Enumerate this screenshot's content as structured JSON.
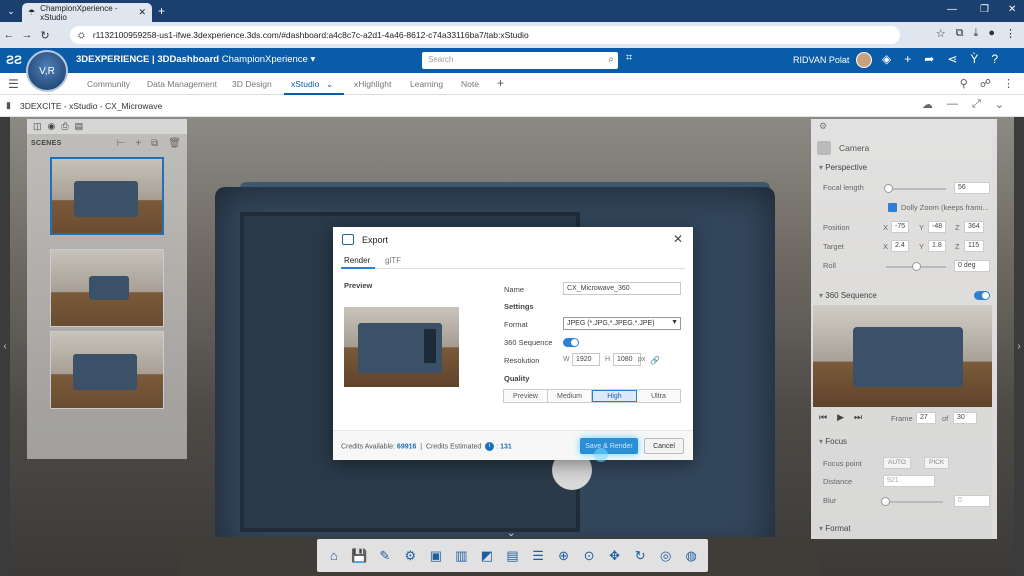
{
  "browser": {
    "tab_title": "ChampionXperience - xStudio",
    "url": "r1132100959258-us1-ifwe.3dexperience.3ds.com/#dashboard:a4c8c7c-a2d1-4a46-8612-c74a33116ba7/tab:xStudio"
  },
  "header": {
    "brand_prefix": "3DEXPERIENCE | 3DDashboard",
    "dashboard_name": "ChampionXperience",
    "search_placeholder": "Search",
    "user_name": "RIDVAN Polat",
    "compass_label": "V,R"
  },
  "dashboard_tabs": [
    "Community",
    "Data Management",
    "3D Design",
    "xStudio",
    "xHighlight",
    "Learning",
    "Note"
  ],
  "active_tab": "xStudio",
  "widget": {
    "title": "3DEXCITE - xStudio - CX_Microwave"
  },
  "scenes": {
    "title": "SCENES"
  },
  "camera": {
    "title": "Camera",
    "perspective": "Perspective",
    "focal_length_label": "Focal length",
    "focal_length": "56",
    "dolly_zoom": "Dolly Zoom (keeps frami...",
    "position_label": "Position",
    "position": {
      "x": "-75",
      "y": "-48",
      "z": "364"
    },
    "target_label": "Target",
    "target": {
      "x": "2.4",
      "y": "1.8",
      "z": "115"
    },
    "roll_label": "Roll",
    "roll": "0 deg",
    "sequence_label": "360 Sequence",
    "frame_label": "Frame",
    "frame": "27",
    "of_label": "of",
    "total_frames": "30",
    "focus_label": "Focus",
    "focus_point_label": "Focus point",
    "auto_label": "AUTO",
    "pick_label": "PICK",
    "distance_label": "Distance",
    "distance": "921",
    "blur_label": "Blur",
    "blur": "0",
    "format_label": "Format",
    "x": "X",
    "y": "Y",
    "z": "Z"
  },
  "export_dialog": {
    "title": "Export",
    "tabs": [
      "Render",
      "glTF"
    ],
    "preview_label": "Preview",
    "name_label": "Name",
    "name_value": "CX_Microwave_360",
    "settings_label": "Settings",
    "format_label": "Format",
    "format_value": "JPEG (*.JPG,*.JPEG,*.JPE)",
    "sequence_label": "360 Sequence",
    "resolution_label": "Resolution",
    "width_tag": "W",
    "width": "1920",
    "height_tag": "H",
    "height": "1080",
    "unit": "px",
    "quality_label": "Quality",
    "quality_options": [
      "Preview",
      "Medium",
      "High",
      "Ultra"
    ],
    "quality_selected": "High",
    "credits_available_label": "Credits Available:",
    "credits_available": "69916",
    "credits_estimated_label": "Credits Estimated",
    "credits_estimated": "131",
    "save_render": "Save & Render",
    "cancel": "Cancel"
  },
  "colors": {
    "brand_blue": "#0a5ca8",
    "browser_bar": "#1b3f6f",
    "accent": "#2b7fd1"
  }
}
